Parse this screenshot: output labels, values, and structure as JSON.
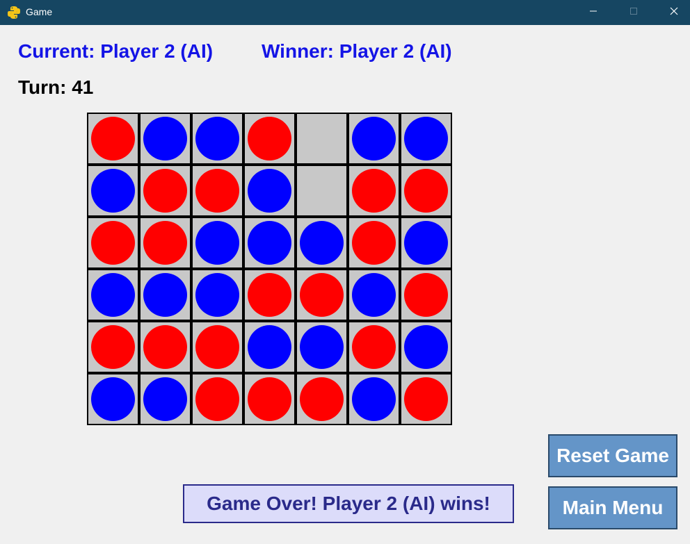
{
  "window": {
    "title": "Game",
    "icon": "python-icon",
    "controls": [
      "minimize-icon",
      "maximize-icon",
      "close-icon"
    ]
  },
  "status": {
    "current": "Current: Player 2 (AI)",
    "winner": "Winner: Player 2 (AI)",
    "turn": "Turn: 41"
  },
  "board": {
    "rows": 6,
    "cols": 7,
    "cells": [
      [
        "red",
        "blue",
        "blue",
        "red",
        "empty",
        "blue",
        "blue"
      ],
      [
        "blue",
        "red",
        "red",
        "blue",
        "empty",
        "red",
        "red"
      ],
      [
        "red",
        "red",
        "blue",
        "blue",
        "blue",
        "red",
        "blue"
      ],
      [
        "blue",
        "blue",
        "blue",
        "red",
        "red",
        "blue",
        "red"
      ],
      [
        "red",
        "red",
        "red",
        "blue",
        "blue",
        "red",
        "blue"
      ],
      [
        "blue",
        "blue",
        "red",
        "red",
        "red",
        "blue",
        "red"
      ]
    ]
  },
  "buttons": {
    "reset": "Reset Game",
    "menu": "Main Menu"
  },
  "message": "Game Over! Player 2 (AI) wins!",
  "colors": {
    "player1": "#ff0000",
    "player2": "#0000ff",
    "cell": "#c8c8c8",
    "status_text": "#1414e6",
    "button": "#6495c8",
    "titlebar": "#164662"
  }
}
